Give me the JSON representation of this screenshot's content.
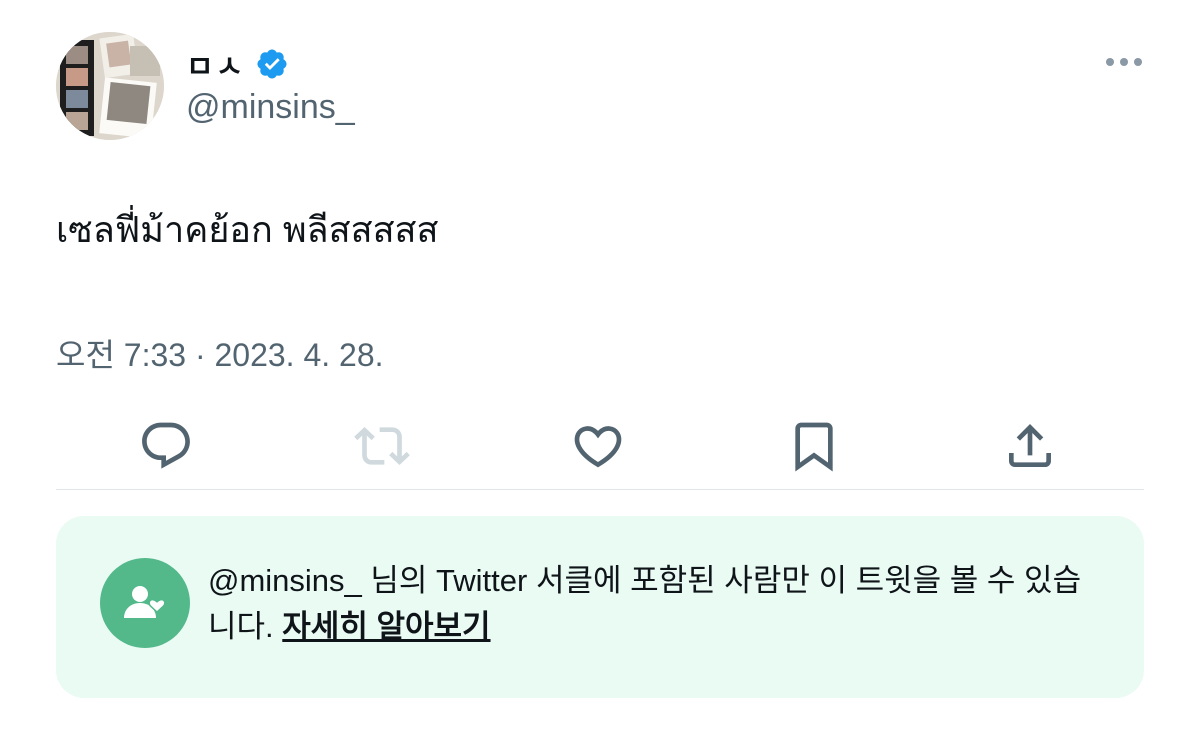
{
  "author": {
    "display_name": "ㅁㅅ",
    "handle": "@minsins_",
    "verified": true
  },
  "tweet": {
    "text": "เซลฟี่ม้าคย้อก พลีสสสสส",
    "timestamp": "오전 7:33 · 2023. 4. 28."
  },
  "actions": [
    {
      "icon": "reply-icon"
    },
    {
      "icon": "retweet-icon",
      "disabled": true
    },
    {
      "icon": "like-icon"
    },
    {
      "icon": "bookmark-icon"
    },
    {
      "icon": "share-icon"
    }
  ],
  "circle_notice": {
    "text": "@minsins_ 님의 Twitter 서클에 포함된 사람만 이 트윗을 볼 수 있습니다.",
    "link": "자세히 알아보기"
  },
  "colors": {
    "verified": "#1d9bf0",
    "icon": "#536471",
    "icon_disabled": "#cfd9de",
    "circle_bg": "#eafbf4",
    "circle_icon": "#53b88a"
  }
}
